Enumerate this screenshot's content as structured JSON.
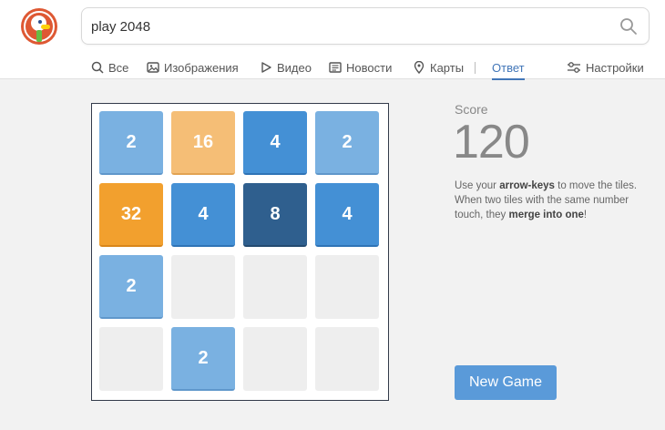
{
  "search": {
    "query": "play 2048"
  },
  "nav": {
    "items": [
      {
        "label": "Все",
        "icon": "search-icon"
      },
      {
        "label": "Изображения",
        "icon": "image-icon"
      },
      {
        "label": "Видео",
        "icon": "play-icon"
      },
      {
        "label": "Новости",
        "icon": "newspaper-icon"
      },
      {
        "label": "Карты",
        "icon": "map-pin-icon"
      },
      {
        "label": "Ответ",
        "active": true
      },
      {
        "label": "Настройки",
        "icon": "settings-sliders-icon"
      }
    ]
  },
  "game": {
    "board": [
      [
        2,
        16,
        4,
        2
      ],
      [
        32,
        4,
        8,
        4
      ],
      [
        2,
        null,
        null,
        null
      ],
      [
        null,
        2,
        null,
        null
      ]
    ],
    "score_label": "Score",
    "score": "120",
    "instructions": {
      "p1": "Use your ",
      "k1": "arrow-keys",
      "p2": " to move the tiles. When two tiles with the same number touch, they ",
      "k2": "merge into one",
      "p3": "!"
    },
    "new_game_label": "New Game"
  },
  "colors": {
    "brand": "#de5833",
    "accent": "#4276b8",
    "tile_2": "#7ab1e1",
    "tile_4": "#4490d5",
    "tile_8": "#2f5f8e",
    "tile_16": "#f5be76",
    "tile_32": "#f2a02e",
    "button": "#5a9ad9"
  }
}
